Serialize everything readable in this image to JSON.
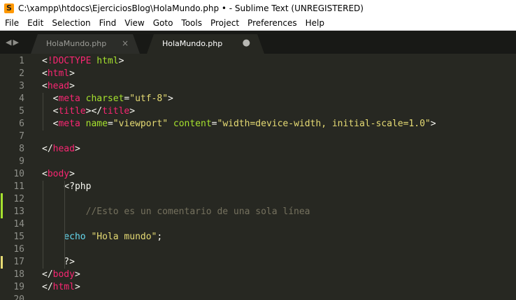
{
  "window": {
    "title": "C:\\xampp\\htdocs\\EjerciciosBlog\\HolaMundo.php • - Sublime Text (UNREGISTERED)",
    "icon": "sublime-text-icon"
  },
  "menu": [
    "File",
    "Edit",
    "Selection",
    "Find",
    "View",
    "Goto",
    "Tools",
    "Project",
    "Preferences",
    "Help"
  ],
  "tabs": [
    {
      "label": "HolaMundo.php",
      "active": false,
      "close_glyph": "×"
    },
    {
      "label": "HolaMundo.php",
      "active": true,
      "dirty_glyph": "●"
    }
  ],
  "nav_arrows": "◀▶",
  "colors": {
    "background": "#272822",
    "gutter_modified": "#e6db74",
    "gutter_added": "#a6e22e",
    "tag": "#f92672",
    "attribute": "#a6e22e",
    "string": "#e6db74",
    "keyword": "#66d9ef",
    "comment": "#75715e"
  },
  "lines": [
    {
      "n": "1",
      "tokens": [
        [
          "p",
          "<"
        ],
        [
          "t",
          "!DOCTYPE"
        ],
        [
          "p",
          " "
        ],
        [
          "a",
          "html"
        ],
        [
          "p",
          ">"
        ]
      ]
    },
    {
      "n": "2",
      "tokens": [
        [
          "p",
          "<"
        ],
        [
          "t",
          "html"
        ],
        [
          "p",
          ">"
        ]
      ]
    },
    {
      "n": "3",
      "tokens": [
        [
          "p",
          "<"
        ],
        [
          "t",
          "head"
        ],
        [
          "p",
          ">"
        ]
      ]
    },
    {
      "n": "4",
      "tokens": [
        [
          "p",
          "  <"
        ],
        [
          "t",
          "meta"
        ],
        [
          "p",
          " "
        ],
        [
          "a",
          "charset"
        ],
        [
          "p",
          "="
        ],
        [
          "s",
          "\"utf-8\""
        ],
        [
          "p",
          ">"
        ]
      ]
    },
    {
      "n": "5",
      "tokens": [
        [
          "p",
          "  <"
        ],
        [
          "t",
          "title"
        ],
        [
          "p",
          "></"
        ],
        [
          "t",
          "title"
        ],
        [
          "p",
          ">"
        ]
      ]
    },
    {
      "n": "6",
      "tokens": [
        [
          "p",
          "  <"
        ],
        [
          "t",
          "meta"
        ],
        [
          "p",
          " "
        ],
        [
          "a",
          "name"
        ],
        [
          "p",
          "="
        ],
        [
          "s",
          "\"viewport\""
        ],
        [
          "p",
          " "
        ],
        [
          "a",
          "content"
        ],
        [
          "p",
          "="
        ],
        [
          "s",
          "\"width=device-width, initial-scale=1.0\""
        ],
        [
          "p",
          ">"
        ]
      ]
    },
    {
      "n": "7",
      "tokens": []
    },
    {
      "n": "8",
      "tokens": [
        [
          "p",
          "</"
        ],
        [
          "t",
          "head"
        ],
        [
          "p",
          ">"
        ]
      ]
    },
    {
      "n": "9",
      "tokens": []
    },
    {
      "n": "10",
      "tokens": [
        [
          "p",
          "<"
        ],
        [
          "t",
          "body"
        ],
        [
          "p",
          ">"
        ]
      ]
    },
    {
      "n": "11",
      "tokens": [
        [
          "p",
          "    <?php"
        ]
      ]
    },
    {
      "n": "12",
      "tokens": [],
      "gutter": "added"
    },
    {
      "n": "13",
      "tokens": [
        [
          "c",
          "        //Esto es un comentario de una sola línea"
        ]
      ],
      "gutter": "added"
    },
    {
      "n": "14",
      "tokens": []
    },
    {
      "n": "15",
      "tokens": [
        [
          "k",
          "    echo"
        ],
        [
          "p",
          " "
        ],
        [
          "s",
          "\"Hola mundo\""
        ],
        [
          "p",
          ";"
        ]
      ]
    },
    {
      "n": "16",
      "tokens": []
    },
    {
      "n": "17",
      "tokens": [
        [
          "p",
          "    ?>"
        ]
      ],
      "gutter": "modified"
    },
    {
      "n": "18",
      "tokens": [
        [
          "p",
          "</"
        ],
        [
          "t",
          "body"
        ],
        [
          "p",
          ">"
        ]
      ]
    },
    {
      "n": "19",
      "tokens": [
        [
          "p",
          "</"
        ],
        [
          "t",
          "html"
        ],
        [
          "p",
          ">"
        ]
      ]
    },
    {
      "n": "20",
      "tokens": []
    }
  ]
}
